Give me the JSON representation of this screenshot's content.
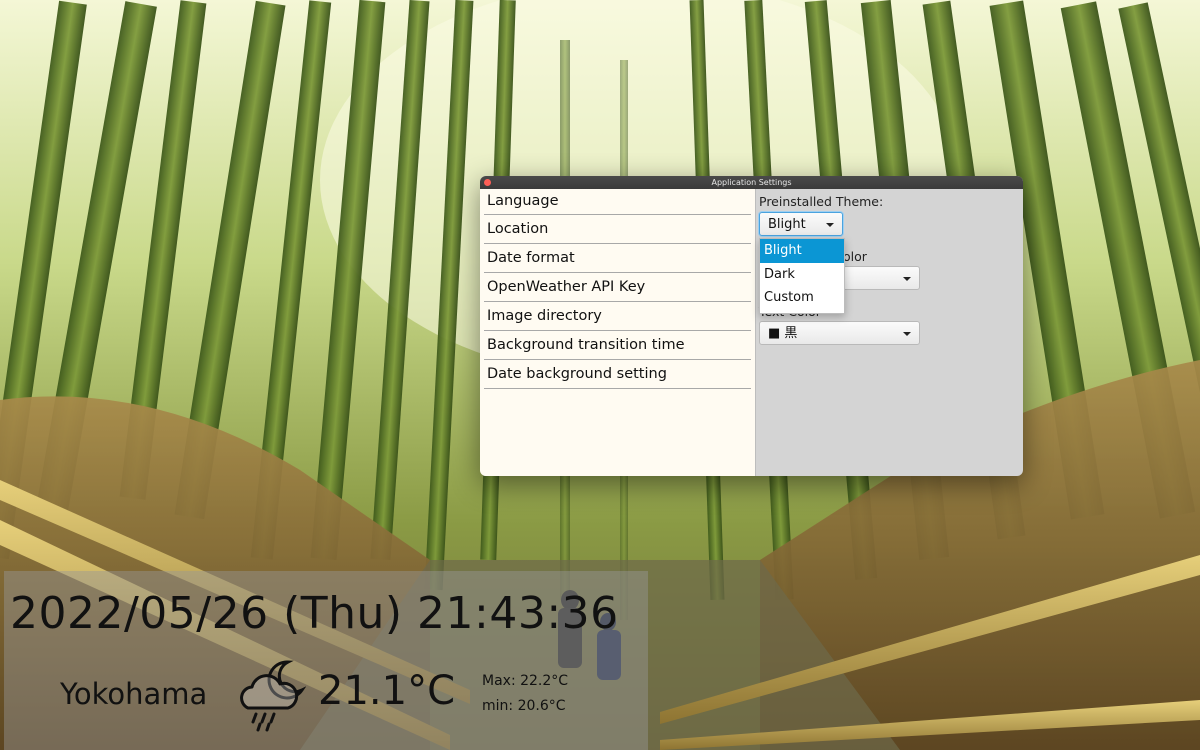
{
  "window": {
    "title": "Application Settings"
  },
  "menu": {
    "items": [
      {
        "label": "Language"
      },
      {
        "label": "Location"
      },
      {
        "label": "Date format"
      },
      {
        "label": "OpenWeather API Key"
      },
      {
        "label": "Image directory"
      },
      {
        "label": "Background transition time"
      },
      {
        "label": "Date background setting"
      }
    ]
  },
  "settings": {
    "theme_label": "Preinstalled Theme:",
    "theme_value": "Blight",
    "theme_options": [
      "Blight",
      "Dark",
      "Custom"
    ],
    "theme_selected": "Blight",
    "bg_color_label": "olor",
    "text_color_label": "Text Color",
    "text_color_value": "■ 黒"
  },
  "widget": {
    "datetime": "2022/05/26 (Thu) 21:43:36",
    "city": "Yokohama",
    "weather_icon": "cloud-moon-rain-icon",
    "temperature": "21.1°C",
    "max": "Max: 22.2°C",
    "min": "min: 20.6°C"
  },
  "colors": {
    "accent": "#0b96d4",
    "close_button": "#fe5f57"
  }
}
